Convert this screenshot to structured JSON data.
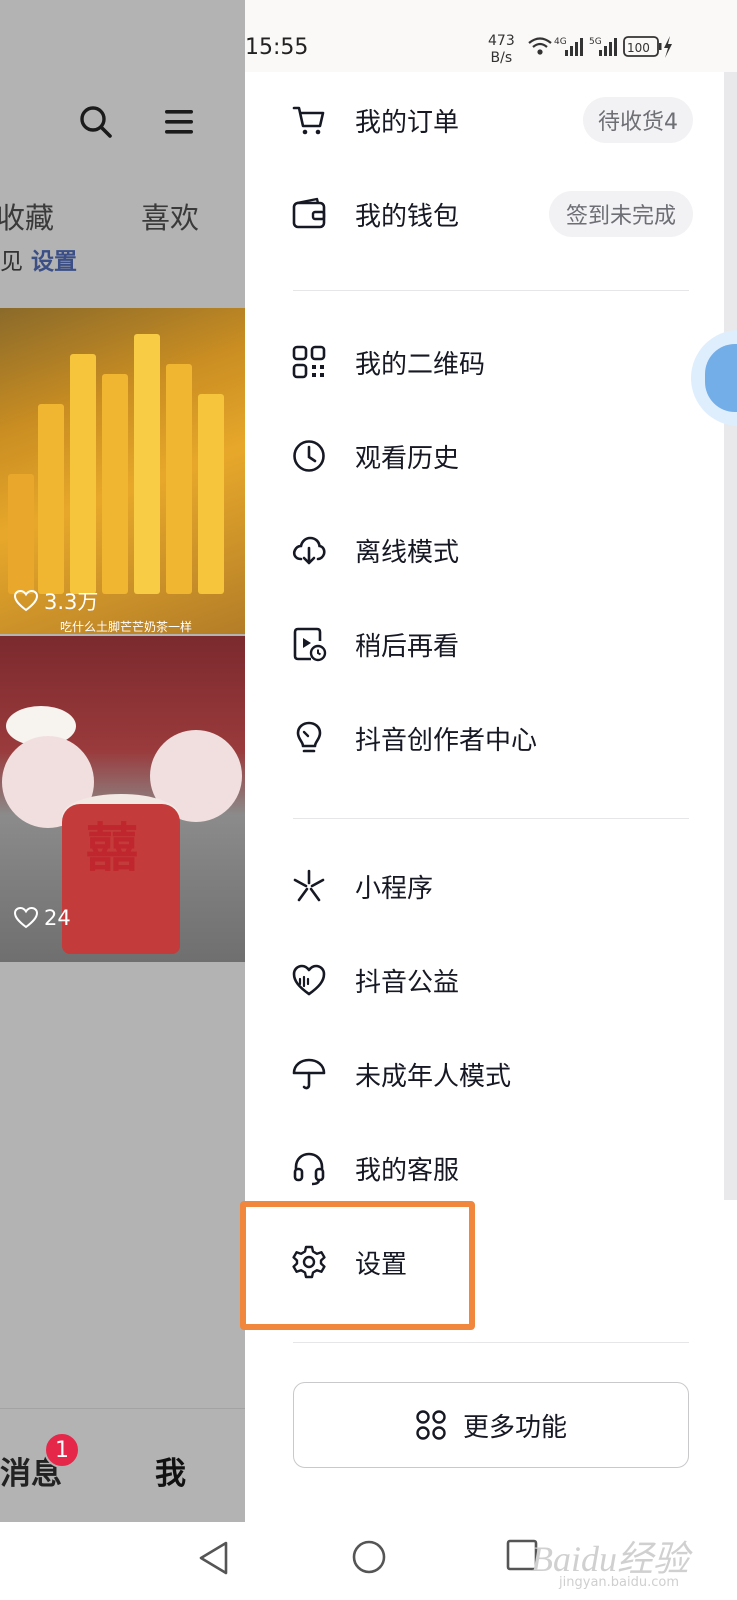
{
  "status_bar": {
    "time": "15:55",
    "net_speed_value": "473",
    "net_speed_unit": "B/s",
    "battery": "100"
  },
  "background": {
    "tabs": [
      "收藏",
      "喜欢"
    ],
    "hint_text": "见",
    "hint_link": "设置",
    "videos": [
      {
        "likes": "3.3万",
        "caption": "吃什么土脚芒芒奶茶一样"
      },
      {
        "likes": "24"
      }
    ],
    "bottom_nav": {
      "messages": "消息",
      "messages_badge": "1",
      "me": "我"
    }
  },
  "drawer": {
    "group1": [
      {
        "label": "我的订单",
        "icon": "cart-icon",
        "pill": "待收货4"
      },
      {
        "label": "我的钱包",
        "icon": "wallet-icon",
        "pill": "签到未完成"
      }
    ],
    "group2": [
      {
        "label": "我的二维码",
        "icon": "qr-code-icon"
      },
      {
        "label": "观看历史",
        "icon": "clock-icon"
      },
      {
        "label": "离线模式",
        "icon": "cloud-download-icon"
      },
      {
        "label": "稍后再看",
        "icon": "watch-later-icon"
      },
      {
        "label": "抖音创作者中心",
        "icon": "lightbulb-icon"
      }
    ],
    "group3": [
      {
        "label": "小程序",
        "icon": "mini-program-icon"
      },
      {
        "label": "抖音公益",
        "icon": "charity-heart-icon"
      },
      {
        "label": "未成年人模式",
        "icon": "umbrella-icon"
      },
      {
        "label": "我的客服",
        "icon": "headset-icon"
      },
      {
        "label": "设置",
        "icon": "gear-icon"
      }
    ],
    "more_button": "更多功能"
  },
  "watermark": {
    "main": "Baidu经验",
    "sub": "jingyan.baidu.com"
  },
  "colors": {
    "highlight": "#f0873c",
    "badge": "#e5284a",
    "overlay": "#b3b3b3"
  }
}
